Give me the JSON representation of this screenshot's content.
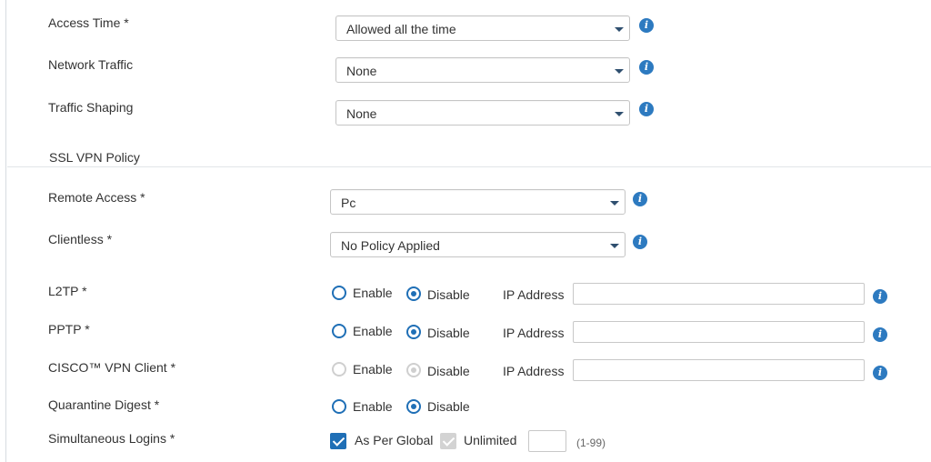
{
  "fields": {
    "access_time": {
      "label": "Access Time *",
      "value": "Allowed all the time"
    },
    "network_traffic": {
      "label": "Network Traffic",
      "value": "None"
    },
    "traffic_shaping": {
      "label": "Traffic Shaping",
      "value": "None"
    },
    "section_title": "SSL VPN Policy",
    "remote_access": {
      "label": "Remote Access *",
      "value": "Pc"
    },
    "clientless": {
      "label": "Clientless *",
      "value": "No Policy Applied"
    },
    "l2tp": {
      "label": "L2TP *",
      "enable": "Enable",
      "disable": "Disable",
      "ip_label": "IP Address",
      "ip_value": "",
      "selected": "disable"
    },
    "pptp": {
      "label": "PPTP *",
      "enable": "Enable",
      "disable": "Disable",
      "ip_label": "IP Address",
      "ip_value": "",
      "selected": "disable"
    },
    "cisco": {
      "label": "CISCO™ VPN Client *",
      "enable": "Enable",
      "disable": "Disable",
      "ip_label": "IP Address",
      "ip_value": "",
      "selected": "disable",
      "disabled": true
    },
    "quarantine": {
      "label": "Quarantine Digest *",
      "enable": "Enable",
      "disable": "Disable",
      "selected": "disable"
    },
    "simultaneous": {
      "label": "Simultaneous Logins *",
      "as_per_global": "As Per Global",
      "unlimited": "Unlimited",
      "count_value": "",
      "range_hint": "(1-99)"
    }
  },
  "icons": {
    "info": "info-icon",
    "caret": "chevron-down-icon"
  },
  "colors": {
    "accent": "#1f6fb6",
    "info": "#2d7ac0",
    "disabled": "#cfcfcf"
  }
}
